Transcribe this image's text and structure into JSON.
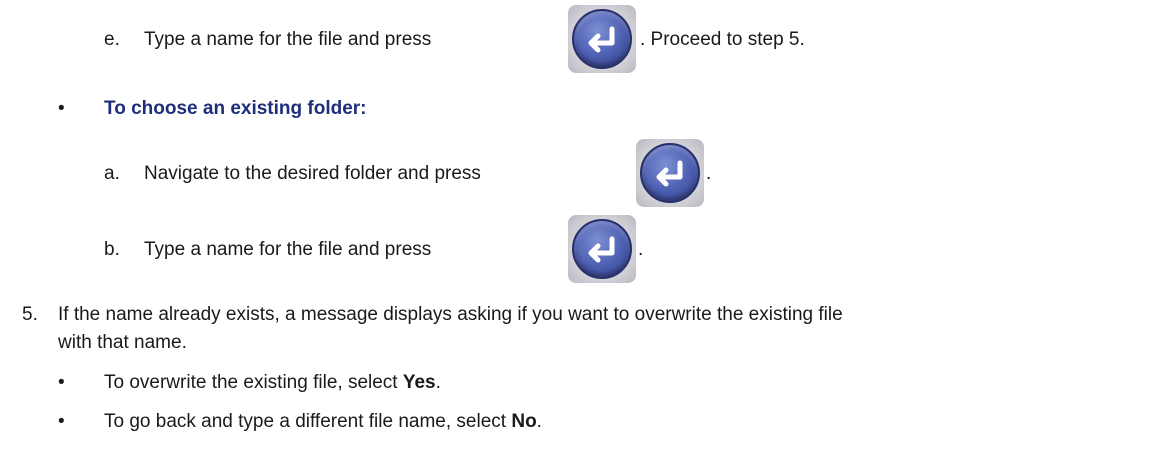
{
  "enter_icon_name": "enter-return-icon",
  "colors": {
    "heading": "#1f2f7a",
    "button": "#4b5db0"
  },
  "step_e": {
    "marker": "e.",
    "text_before": "Type a name for the file and press",
    "text_after": ". Proceed to step 5."
  },
  "existing_folder": {
    "bullet": "•",
    "heading": "To choose an existing folder:",
    "step_a": {
      "marker": "a.",
      "text_before": "Navigate to the desired folder and press",
      "text_after": "."
    },
    "step_b": {
      "marker": "b.",
      "text_before": "Type a name for the file and press",
      "text_after": "."
    }
  },
  "step_5": {
    "marker": "5.",
    "line1": "If the name already exists, a message displays asking if you want to overwrite the existing file",
    "line2": "with that name.",
    "bullets": [
      {
        "bullet": "•",
        "text": "To overwrite the existing file, select ",
        "bold": "Yes",
        "tail": "."
      },
      {
        "bullet": "•",
        "text": "To go back and type a different file name, select ",
        "bold": "No",
        "tail": "."
      }
    ]
  }
}
